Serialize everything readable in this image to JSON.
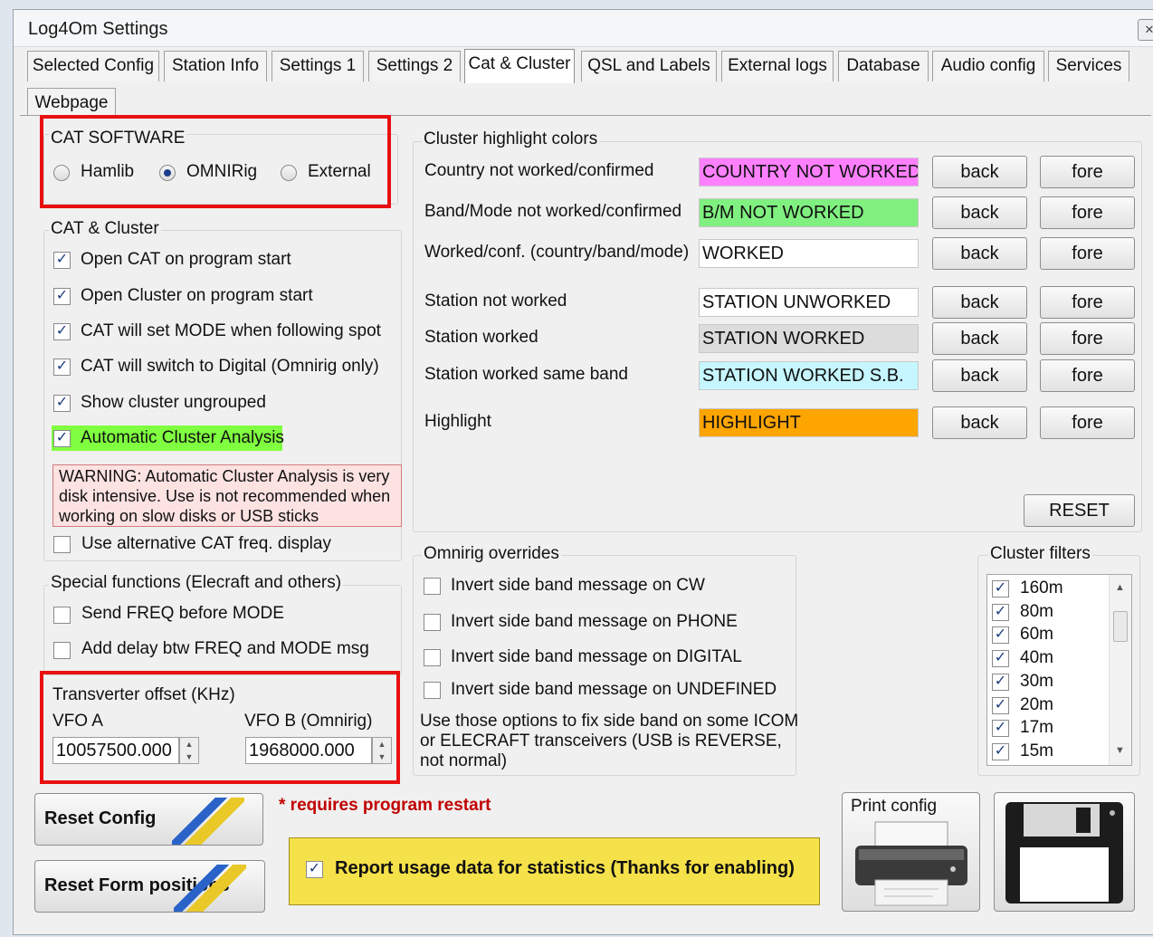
{
  "window": {
    "title": "Log4Om Settings",
    "close_glyph": "✕"
  },
  "tabs": [
    {
      "label": "Selected Config",
      "active": false
    },
    {
      "label": "Station Info",
      "active": false
    },
    {
      "label": "Settings 1",
      "active": false
    },
    {
      "label": "Settings 2",
      "active": false
    },
    {
      "label": "Cat & Cluster",
      "active": true
    },
    {
      "label": "QSL and Labels",
      "active": false
    },
    {
      "label": "External logs",
      "active": false
    },
    {
      "label": "Database",
      "active": false
    },
    {
      "label": "Audio config",
      "active": false
    },
    {
      "label": "Services",
      "active": false
    },
    {
      "label": "Webpage",
      "active": false
    }
  ],
  "cat_software": {
    "title": "CAT SOFTWARE",
    "options": [
      {
        "label": "Hamlib",
        "selected": false
      },
      {
        "label": "OMNIRig",
        "selected": true
      },
      {
        "label": "External",
        "selected": false
      }
    ]
  },
  "cat_cluster": {
    "title": "CAT & Cluster",
    "options": [
      {
        "label": "Open CAT on program start",
        "checked": true
      },
      {
        "label": "Open Cluster on program start",
        "checked": true
      },
      {
        "label": "CAT will set MODE when following spot",
        "checked": true
      },
      {
        "label": "CAT will switch to Digital (Omnirig only)",
        "checked": true
      },
      {
        "label": "Show cluster ungrouped",
        "checked": true
      },
      {
        "label": "Automatic Cluster Analysis",
        "checked": true,
        "highlight_color": "#80ff40"
      }
    ],
    "warning": "WARNING: Automatic Cluster Analysis is very disk intensive. Use is not recommended when working on slow disks or USB sticks",
    "alt_display": {
      "label": "Use alternative CAT freq. display",
      "checked": false
    }
  },
  "special_functions": {
    "title": "Special functions (Elecraft and others)",
    "options": [
      {
        "label": "Send FREQ before MODE",
        "checked": false
      },
      {
        "label": "Add delay btw FREQ and MODE msg",
        "checked": false
      }
    ]
  },
  "transverter": {
    "title": "Transverter offset (KHz)",
    "vfo_a_label": "VFO A",
    "vfo_a_value": "10057500.000",
    "vfo_b_label": "VFO B (Omnirig)",
    "vfo_b_value": "1968000.000"
  },
  "highlight_colors": {
    "title": "Cluster highlight colors",
    "back_label": "back",
    "fore_label": "fore",
    "rows": [
      {
        "label": "Country not worked/confirmed",
        "sample": "COUNTRY NOT WORKED",
        "bg": "#ff80ff",
        "fg": "#111111"
      },
      {
        "label": "Band/Mode not worked/confirmed",
        "sample": "B/M NOT WORKED",
        "bg": "#80f080",
        "fg": "#111111"
      },
      {
        "label": "Worked/conf. (country/band/mode)",
        "sample": "WORKED",
        "bg": "#ffffff",
        "fg": "#111111"
      },
      {
        "label": "Station not worked",
        "sample": "STATION UNWORKED",
        "bg": "#ffffff",
        "fg": "#111111"
      },
      {
        "label": "Station worked",
        "sample": "STATION WORKED",
        "bg": "#dcdcdc",
        "fg": "#111111"
      },
      {
        "label": "Station worked same band",
        "sample": "STATION WORKED S.B.",
        "bg": "#c6f6ff",
        "fg": "#111111"
      },
      {
        "label": "Highlight",
        "sample": "HIGHLIGHT",
        "bg": "#ffa500",
        "fg": "#111111"
      }
    ],
    "reset_label": "RESET"
  },
  "omnirig": {
    "title": "Omnirig overrides",
    "options": [
      {
        "label": "Invert side band message on CW",
        "checked": false
      },
      {
        "label": "Invert side band message on PHONE",
        "checked": false
      },
      {
        "label": "Invert side band message on DIGITAL",
        "checked": false
      },
      {
        "label": "Invert side band message on UNDEFINED",
        "checked": false
      }
    ],
    "note_line1": "Use those options to fix side band on some ICOM",
    "note_line2": "or ELECRAFT transceivers (USB is REVERSE,",
    "note_line3": "not normal)"
  },
  "cluster_filters": {
    "title": "Cluster filters",
    "bands": [
      {
        "label": "160m",
        "checked": true
      },
      {
        "label": "80m",
        "checked": true
      },
      {
        "label": "60m",
        "checked": true
      },
      {
        "label": "40m",
        "checked": true
      },
      {
        "label": "30m",
        "checked": true
      },
      {
        "label": "20m",
        "checked": true
      },
      {
        "label": "17m",
        "checked": true
      },
      {
        "label": "15m",
        "checked": true
      }
    ]
  },
  "bottom": {
    "reset_config": "Reset Config",
    "reset_form": "Reset Form positions",
    "restart_note": "* requires program restart",
    "usage_label": "Report usage data for statistics (Thanks for enabling)",
    "usage_checked": true,
    "print_config": "Print config"
  },
  "colors": {
    "red_highlight": "#e81010",
    "usage_bg": "#f5e14a",
    "restart_note": "#c00000"
  }
}
